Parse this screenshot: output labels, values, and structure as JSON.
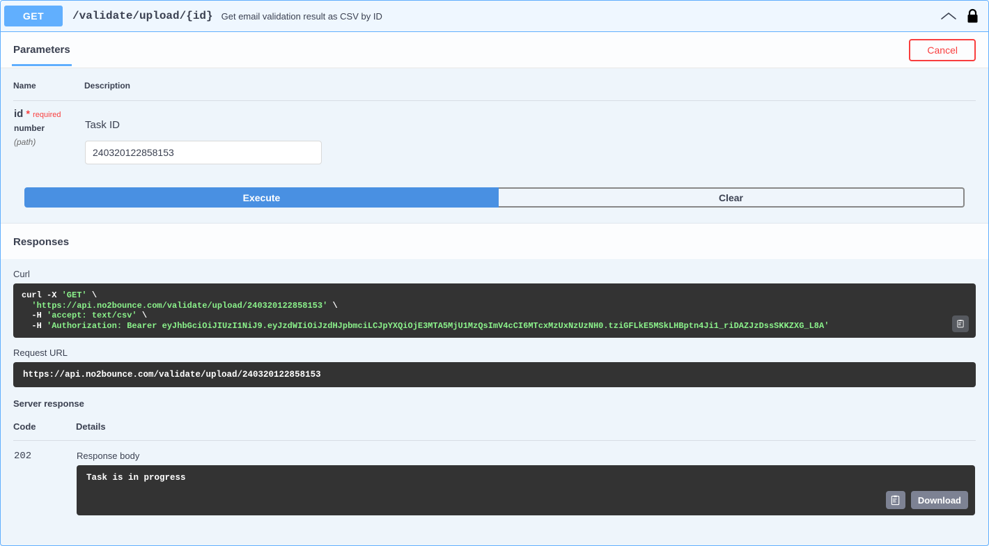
{
  "operation": {
    "method": "GET",
    "path": "/validate/upload/{id}",
    "summary": "Get email validation result as CSV by ID",
    "collapse_icon": "chevron-up-icon",
    "auth_icon": "lock-icon",
    "accent_color": "#61affe"
  },
  "tabs": [
    {
      "label": "Parameters",
      "active": true
    }
  ],
  "actions": {
    "cancel_label": "Cancel",
    "cancel_color": "#f93e3e",
    "execute_label": "Execute",
    "execute_color": "#4990e2",
    "clear_label": "Clear"
  },
  "parameters": {
    "headers": {
      "name": "Name",
      "description": "Description"
    },
    "rows": [
      {
        "name": "id",
        "required_star": "*",
        "required_label": "required",
        "type": "number",
        "location": "(path)",
        "description": "Task ID",
        "value": "240320122858153",
        "placeholder": "id"
      }
    ]
  },
  "responses": {
    "section_title": "Responses",
    "curl_label": "Curl",
    "curl": {
      "line1_cmd": "curl -X ",
      "line1_str": "'GET'",
      "line1_cont": " \\",
      "line2_str": "  'https://api.no2bounce.com/validate/upload/240320122858153'",
      "line2_cont": " \\",
      "line3_flag": "  -H ",
      "line3_str": "'accept: text/csv'",
      "line3_cont": " \\",
      "line4_flag": "  -H ",
      "line4_str": "'Authorization: Bearer eyJhbGciOiJIUzI1NiJ9.eyJzdWIiOiJzdHJpbmciLCJpYXQiOjE3MTA5MjU1MzQsImV4cCI6MTcxMzUxNzUzNH0.tziGFLkE5MSkLHBptn4Ji1_riDAZJzDssSKKZXG_L8A'"
    },
    "copy_icon": "clipboard-copy-icon",
    "request_url_label": "Request URL",
    "request_url": "https://api.no2bounce.com/validate/upload/240320122858153",
    "server_response_label": "Server response",
    "table_headers": {
      "code": "Code",
      "details": "Details"
    },
    "response_code": "202",
    "response_body_label": "Response body",
    "response_body": "Task is in progress",
    "download_label": "Download",
    "download_copy_icon": "clipboard-copy-icon"
  }
}
